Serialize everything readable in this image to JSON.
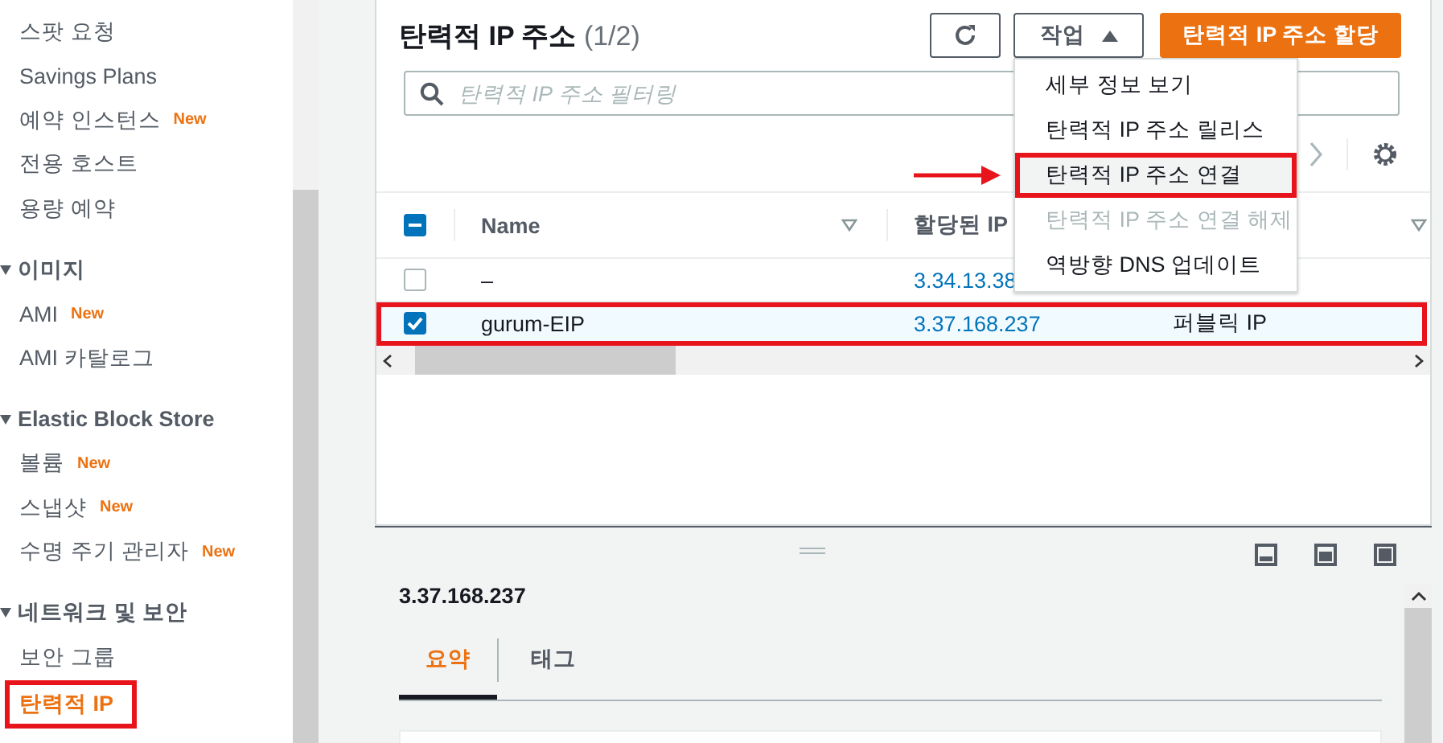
{
  "sidebar": {
    "items": [
      {
        "label": "스팟 요청",
        "selected": false,
        "highlighted": false
      },
      {
        "label": "Savings Plans",
        "selected": false,
        "highlighted": false
      },
      {
        "label": "예약 인스턴스",
        "badge": "New",
        "selected": false,
        "highlighted": false
      },
      {
        "label": "전용 호스트",
        "selected": false,
        "highlighted": false
      },
      {
        "label": "용량 예약",
        "selected": false,
        "highlighted": false
      }
    ],
    "sections": [
      {
        "title": "이미지",
        "expanded": true,
        "children": [
          {
            "label": "AMI",
            "badge": "New",
            "selected": false,
            "highlighted": false
          },
          {
            "label": "AMI 카탈로그",
            "selected": false,
            "highlighted": false
          }
        ]
      },
      {
        "title": "Elastic Block Store",
        "expanded": true,
        "children": [
          {
            "label": "볼륨",
            "badge": "New",
            "selected": false,
            "highlighted": false
          },
          {
            "label": "스냅샷",
            "badge": "New",
            "selected": false,
            "highlighted": false
          },
          {
            "label": "수명 주기 관리자",
            "badge": "New",
            "selected": false,
            "highlighted": false
          }
        ]
      },
      {
        "title": "네트워크 및 보안",
        "expanded": true,
        "children": [
          {
            "label": "보안 그룹",
            "selected": false,
            "highlighted": false
          },
          {
            "label": "탄력적 IP",
            "selected": true,
            "highlighted": true
          }
        ]
      }
    ]
  },
  "panel": {
    "title": "탄력적 IP 주소",
    "count": "(1/2)",
    "actions_button": "작업",
    "primary_button": "탄력적 IP 주소 할당",
    "filter": {
      "placeholder": "탄력적 IP 주소 필터링"
    },
    "menu": {
      "items": [
        {
          "label": "세부 정보 보기",
          "disabled": false,
          "highlighted": false
        },
        {
          "label": "탄력적 IP 주소 릴리스",
          "disabled": false,
          "highlighted": false
        },
        {
          "label": "탄력적 IP 주소 연결",
          "disabled": false,
          "highlighted": true
        },
        {
          "label": "탄력적 IP 주소 연결 해제",
          "disabled": true,
          "highlighted": false
        },
        {
          "label": "역방향 DNS 업데이트",
          "disabled": false,
          "highlighted": false
        }
      ]
    }
  },
  "table": {
    "header_partial": true,
    "columns": [
      "Name",
      "할당된 IP"
    ],
    "rows": [
      {
        "selected": false,
        "highlighted": false,
        "name": "–",
        "ip": "3.34.13.38"
      },
      {
        "selected": true,
        "highlighted": true,
        "name": "gurum-EIP",
        "ip": "3.37.168.237",
        "type": "퍼블릭 IP"
      }
    ]
  },
  "details": {
    "title": "3.37.168.237",
    "tabs": [
      {
        "label": "요약",
        "selected": true
      },
      {
        "label": "태그",
        "selected": false
      }
    ]
  }
}
